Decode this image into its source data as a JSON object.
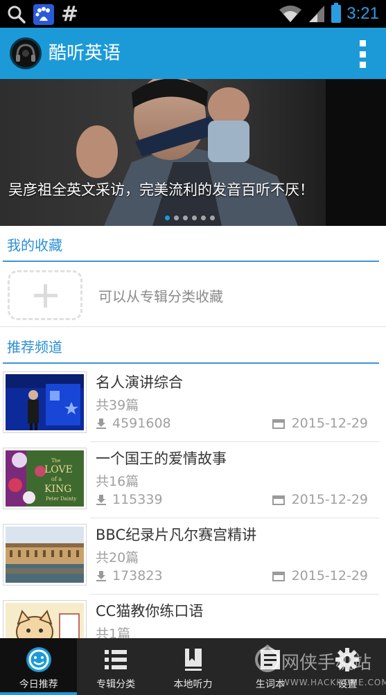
{
  "status_bar": {
    "time": "3:21",
    "icons": [
      "search-icon",
      "baidu-icon",
      "hash-icon",
      "wifi-icon",
      "signal-icon",
      "battery-icon"
    ]
  },
  "app_bar": {
    "title": "酷听英语",
    "logo": "headphones-logo",
    "menu_icon": "overflow-menu-icon"
  },
  "banner": {
    "caption": "吴彦祖全英文采访，完美流利的发音百听不厌！",
    "page_count": 6,
    "active_page": 1
  },
  "favorites": {
    "title": "我的收藏",
    "hint": "可以从专辑分类收藏",
    "add_icon": "add-icon"
  },
  "recommended": {
    "title": "推荐频道",
    "items": [
      {
        "title": "名人演讲综合",
        "count": "共39篇",
        "downloads": "4591608",
        "date": "2015-12-29"
      },
      {
        "title": "一个国王的爱情故事",
        "count": "共16篇",
        "downloads": "115339",
        "date": "2015-12-29",
        "thumb_text": [
          "The",
          "LOVE",
          "of a",
          "KING",
          "Peter Dainty"
        ]
      },
      {
        "title": "BBC纪录片凡尔赛宫精讲",
        "count": "共20篇",
        "downloads": "173823",
        "date": "2015-12-29"
      },
      {
        "title": "CC猫教你练口语",
        "count": "共1篇",
        "downloads": "",
        "date": ""
      }
    ]
  },
  "bottom_nav": {
    "tabs": [
      {
        "label": "今日推荐",
        "icon": "smiley-icon",
        "active": true
      },
      {
        "label": "专辑分类",
        "icon": "list-icon",
        "active": false
      },
      {
        "label": "本地听力",
        "icon": "book-icon",
        "active": false
      },
      {
        "label": "生词本",
        "icon": "vocabulary-icon",
        "active": false
      },
      {
        "label": "设置",
        "icon": "gear-icon",
        "active": false
      }
    ]
  },
  "watermark": {
    "text": "网侠手机站",
    "sub": "WWW.HACKHOME.COM"
  },
  "colors": {
    "primary": "#1c9ad8",
    "section_text": "#2a8fd6",
    "muted_text": "#a0a0a0",
    "nav_background": "#262626"
  }
}
